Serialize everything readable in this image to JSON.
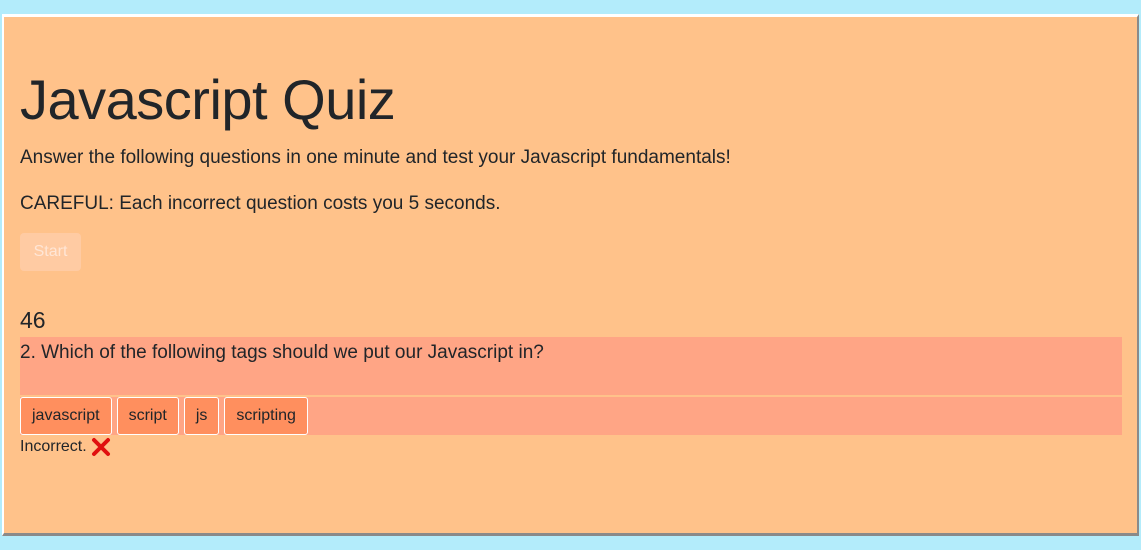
{
  "quiz": {
    "title": "Javascript Quiz",
    "intro": "Answer the following questions in one minute and test your Javascript fundamentals!",
    "warning": "CAREFUL: Each incorrect question costs you 5 seconds.",
    "start_label": "Start",
    "timer": "46",
    "question": "2. Which of the following tags should we put our Javascript in?",
    "choices": [
      "javascript",
      "script",
      "js",
      "scripting"
    ],
    "feedback": "Incorrect.",
    "feedback_icon": "cross-mark-icon"
  },
  "colors": {
    "page_background": "#b3ecfb",
    "panel_background": "#ffc28a",
    "question_background": "#ffa585",
    "choice_button": "#ff8f5e",
    "start_button": "#ffcba3",
    "incorrect_icon": "#e0100f"
  }
}
